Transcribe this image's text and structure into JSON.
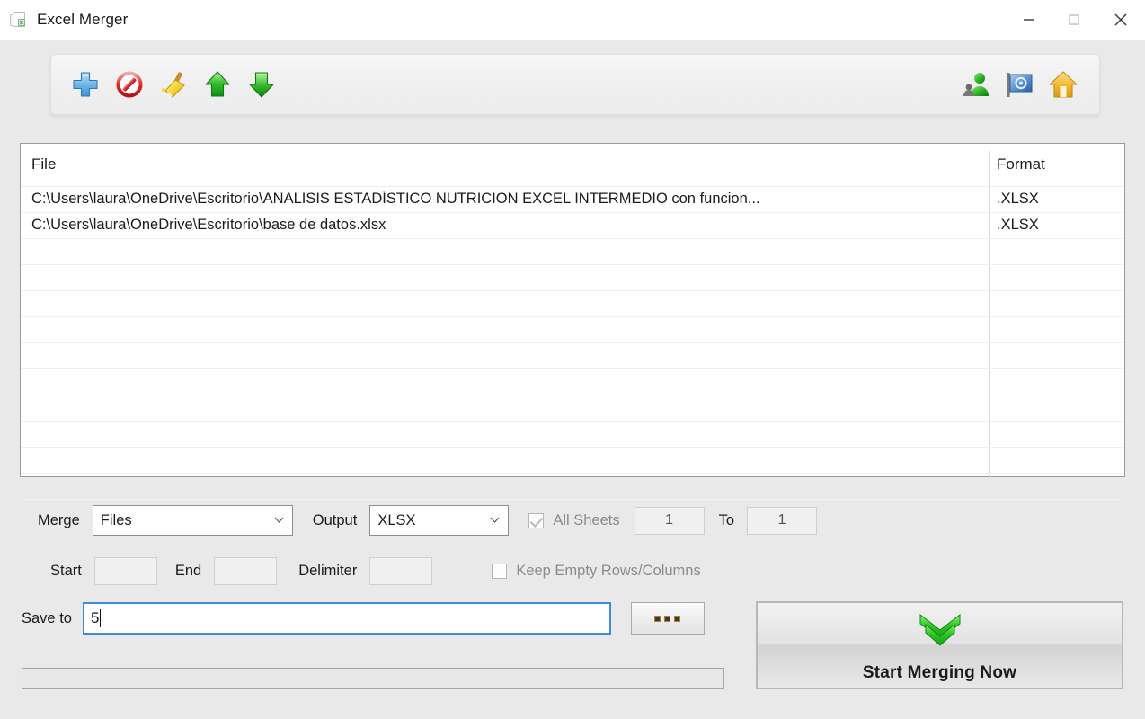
{
  "window": {
    "title": "Excel Merger",
    "app_icon": "excel-document-icon",
    "minimize_label": "Minimize",
    "maximize_label": "Maximize",
    "close_label": "Close"
  },
  "toolbar": {
    "left_buttons": [
      {
        "name": "add-files-button",
        "icon": "blue-plus-icon",
        "label": "Add"
      },
      {
        "name": "remove-files-button",
        "icon": "red-forbidden-icon",
        "label": "Remove"
      },
      {
        "name": "clear-list-button",
        "icon": "yellow-broom-icon",
        "label": "Clear"
      },
      {
        "name": "move-up-button",
        "icon": "green-arrow-up-icon",
        "label": "Move Up"
      },
      {
        "name": "move-down-button",
        "icon": "green-arrow-down-icon",
        "label": "Move Down"
      }
    ],
    "right_buttons": [
      {
        "name": "user-button",
        "icon": "green-person-icon",
        "label": "Account"
      },
      {
        "name": "about-button",
        "icon": "blue-flag-icon",
        "label": "About"
      },
      {
        "name": "home-button",
        "icon": "yellow-home-icon",
        "label": "Home"
      }
    ]
  },
  "file_list": {
    "columns": [
      "File",
      "Format"
    ],
    "rows": [
      {
        "file": "C:\\Users\\laura\\OneDrive\\Escritorio\\ANALISIS ESTADÍSTICO NUTRICION EXCEL INTERMEDIO con funcion...",
        "format": ".XLSX"
      },
      {
        "file": "C:\\Users\\laura\\OneDrive\\Escritorio\\base de datos.xlsx",
        "format": ".XLSX"
      }
    ],
    "empty_row_count": 10
  },
  "options": {
    "merge_label": "Merge",
    "merge_value": "Files",
    "merge_options": [
      "Files"
    ],
    "output_label": "Output",
    "output_value": "XLSX",
    "output_options": [
      "XLSX"
    ],
    "all_sheets_label": "All Sheets",
    "all_sheets_checked": true,
    "sheet_from": "1",
    "to_label": "To",
    "sheet_to": "1",
    "start_label": "Start",
    "start_value": "",
    "end_label": "End",
    "end_value": "",
    "delimiter_label": "Delimiter",
    "delimiter_value": "",
    "keep_empty_label": "Keep Empty Rows/Columns",
    "keep_empty_checked": false,
    "save_to_label": "Save to",
    "save_to_value": "5",
    "browse_label": "..."
  },
  "action": {
    "start_button_label": "Start Merging Now",
    "start_button_icon": "green-double-chevron-down-icon"
  },
  "progress": {
    "value": 0,
    "name": "progress-bar"
  },
  "colors": {
    "focus_border": "#3d8bd6",
    "accent_green": "#2eb82e",
    "window_bg": "#e9e9e9",
    "list_bg": "#ffffff"
  }
}
